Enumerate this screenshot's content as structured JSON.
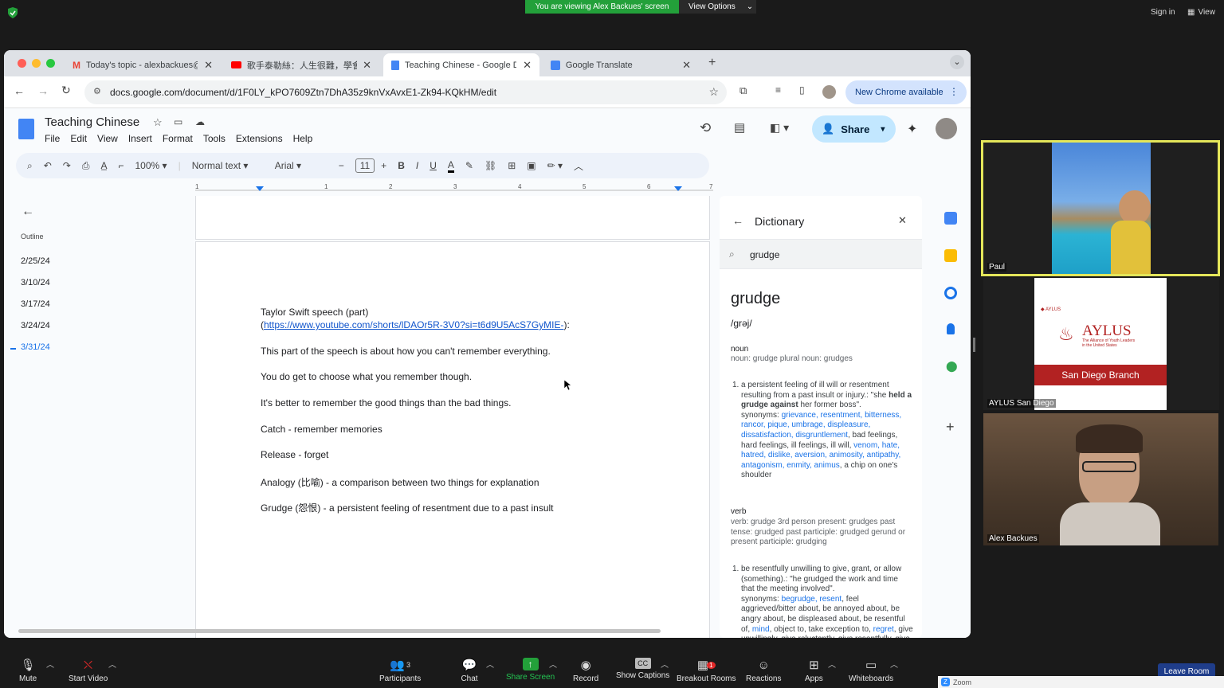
{
  "zoom": {
    "viewing_banner": "You are viewing Alex Backues' screen",
    "view_options": "View Options",
    "sign_in": "Sign in",
    "view": "View",
    "bottom": {
      "mute": "Mute",
      "start_video": "Start Video",
      "participants": "Participants",
      "participants_count": "3",
      "chat": "Chat",
      "share_screen": "Share Screen",
      "record": "Record",
      "show_captions": "Show Captions",
      "breakout_rooms": "Breakout Rooms",
      "breakout_badge": "1",
      "reactions": "Reactions",
      "apps": "Apps",
      "whiteboards": "Whiteboards",
      "leave_room": "Leave Room",
      "zoom_label": "Zoom"
    },
    "participants": [
      {
        "name": "Paul"
      },
      {
        "name": "AYLUS San Diego",
        "logo_title": "AYLUS",
        "logo_sub": "The Alliance of Youth Leaders in the United States",
        "small_brand": "AYLUS",
        "branch": "San Diego Branch"
      },
      {
        "name": "Alex Backues"
      }
    ]
  },
  "chrome": {
    "tabs": [
      {
        "label": "Today's topic - alexbackues@",
        "icon": "gmail-icon"
      },
      {
        "label": "歌手泰勒絲：人生很難，學會...",
        "icon": "youtube-icon"
      },
      {
        "label": "Teaching Chinese - Google D",
        "icon": "docs-icon"
      },
      {
        "label": "Google Translate",
        "icon": "translate-icon"
      }
    ],
    "url": "docs.google.com/document/d/1F0LY_kPO7609Ztn7DhA35z9knVxAvxE1-Zk94-KQkHM/edit",
    "new_chrome": "New Chrome available"
  },
  "docs": {
    "title": "Teaching Chinese",
    "menus": [
      "File",
      "Edit",
      "View",
      "Insert",
      "Format",
      "Tools",
      "Extensions",
      "Help"
    ],
    "share": "Share",
    "toolbar": {
      "zoom": "100%",
      "style": "Normal text",
      "font": "Arial",
      "size": "11"
    },
    "ruler_numbers": [
      "1",
      "1",
      "2",
      "3",
      "4",
      "5",
      "6",
      "7"
    ],
    "outline": {
      "label": "Outline",
      "items": [
        "2/25/24",
        "3/10/24",
        "3/17/24",
        "3/24/24",
        "3/31/24"
      ],
      "active_index": 4
    },
    "content": {
      "line1": "Taylor Swift speech (part)",
      "link_open": "(",
      "link": "https://www.youtube.com/shorts/lDAOr5R-3V0?si=t6d9U5AcS7GyMIE-",
      "link_close": "):",
      "line2": "This part of the speech is about how you can't remember everything.",
      "line3": "You do get to choose what you remember though.",
      "line4": "It's better to remember the good things than the bad things.",
      "line5": "Catch - remember memories",
      "line6": "Release - forget",
      "line7": "Analogy (比喻) - a comparison between two things for explanation",
      "line8": "Grudge (怨恨) - a persistent feeling of resentment due to a past insult"
    },
    "dictionary": {
      "header": "Dictionary",
      "query": "grudge",
      "word": "grudge",
      "pronunciation": "/grəj/",
      "noun_label": "noun",
      "noun_forms": "noun: grudge plural noun: grudges",
      "noun_def_num": "1.",
      "noun_def": "a persistent feeling of ill will or resentment resulting from a past insult or injury.: \"she",
      "noun_ex_bold": "held a grudge against",
      "noun_ex_rest": " her former boss\".",
      "noun_syn_label": "synonyms: ",
      "noun_syn_a": "grievance, resentment, bitterness, rancor, pique, umbrage, displeasure, dissatisfaction, disgruntlement",
      "noun_syn_b": ", bad feelings, hard feelings, ill feelings, ill will, ",
      "noun_syn_c": "venom, hate, hatred, dislike, aversion, animosity, antipathy, antagonism, enmity, animus",
      "noun_syn_d": ", a chip on one's shoulder",
      "verb_label": "verb",
      "verb_forms": "verb: grudge 3rd person present: grudges past tense: grudged past participle: grudged gerund or present participle: grudging",
      "verb_def_num": "1.",
      "verb_def": "be resentfully unwilling to give, grant, or allow (something).: \"he grudged the work and time that the meeting involved\".",
      "verb_syn_label": "synonyms: ",
      "verb_syn_a": "begrudge, resent",
      "verb_syn_b": ", feel aggrieved/bitter about, be annoyed about, be angry about, be displeased about, be resentful of, ",
      "verb_syn_c": "mind",
      "verb_syn_d": ", object to, take exception to, ",
      "verb_syn_e": "regret",
      "verb_syn_f": ", give unwillingly, give reluctantly, give resentfully, give stintingly"
    }
  },
  "colors": {
    "zoom_green": "#23a03a",
    "chrome_tab_bg": "#dee1e6",
    "docs_share": "#c2e7ff",
    "link_blue": "#1155cc",
    "active_outline": "#1a73e8",
    "speaker_border": "#e4e65a"
  }
}
